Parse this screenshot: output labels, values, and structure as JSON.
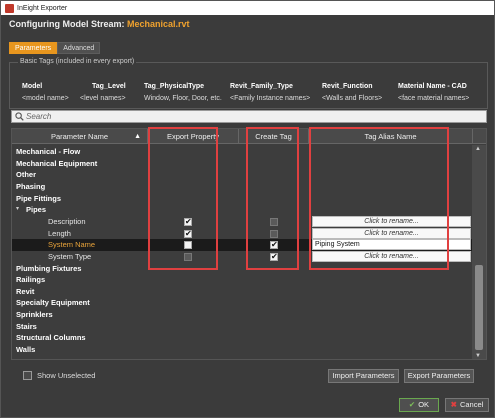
{
  "window": {
    "title": "InEight Exporter"
  },
  "header": {
    "prefix": "Configuring Model Stream:",
    "file": "Mechanical.rvt"
  },
  "tabs": [
    {
      "label": "Parameters",
      "active": true
    },
    {
      "label": "Advanced",
      "active": false
    }
  ],
  "basic_tags": {
    "legend": "Basic Tags (included in every export)",
    "names": [
      "Model",
      "Tag_Level",
      "Tag_PhysicalType",
      "Revit_Family_Type",
      "Revit_Function",
      "Material Name - CAD"
    ],
    "values": [
      "<model name>",
      "<level names>",
      "Window, Floor, Door, etc.",
      "<Family Instance names>",
      "<Walls and Floors>",
      "<face material names>"
    ]
  },
  "search": {
    "placeholder": "Search"
  },
  "grid": {
    "columns": [
      "Parameter Name",
      "Export Property",
      "Create Tag",
      "Tag Alias Name"
    ],
    "rows": [
      {
        "label": "Mechanical - Flow",
        "type": "group"
      },
      {
        "label": "Mechanical Equipment",
        "type": "group"
      },
      {
        "label": "Other",
        "type": "group"
      },
      {
        "label": "Phasing",
        "type": "group"
      },
      {
        "label": "Pipe Fittings",
        "type": "group"
      },
      {
        "label": "Pipes",
        "type": "group-expanded"
      },
      {
        "label": "Description",
        "type": "child",
        "export": true,
        "tag": false,
        "tag_enabled": false,
        "alias": "Click to rename..."
      },
      {
        "label": "Length",
        "type": "child",
        "export": true,
        "tag": false,
        "tag_enabled": false,
        "alias": "Click to rename..."
      },
      {
        "label": "System Name",
        "type": "child",
        "selected": true,
        "export": false,
        "tag": true,
        "tag_enabled": true,
        "alias": "Piping System"
      },
      {
        "label": "System Type",
        "type": "child",
        "export": false,
        "export_enabled": false,
        "tag": true,
        "tag_enabled": true,
        "alias": "Click to rename..."
      },
      {
        "label": "Plumbing Fixtures",
        "type": "group"
      },
      {
        "label": "Railings",
        "type": "group"
      },
      {
        "label": "Revit",
        "type": "group"
      },
      {
        "label": "Specialty Equipment",
        "type": "group"
      },
      {
        "label": "Sprinklers",
        "type": "group"
      },
      {
        "label": "Stairs",
        "type": "group"
      },
      {
        "label": "Structural Columns",
        "type": "group"
      },
      {
        "label": "Walls",
        "type": "group"
      }
    ]
  },
  "footer": {
    "show_unselected": "Show Unselected",
    "import": "Import Parameters",
    "export": "Export Parameters",
    "ok": "OK",
    "cancel": "Cancel"
  },
  "colors": {
    "accent": "#e8961e",
    "highlight": "#e04040",
    "background": "#3b3b3b"
  }
}
